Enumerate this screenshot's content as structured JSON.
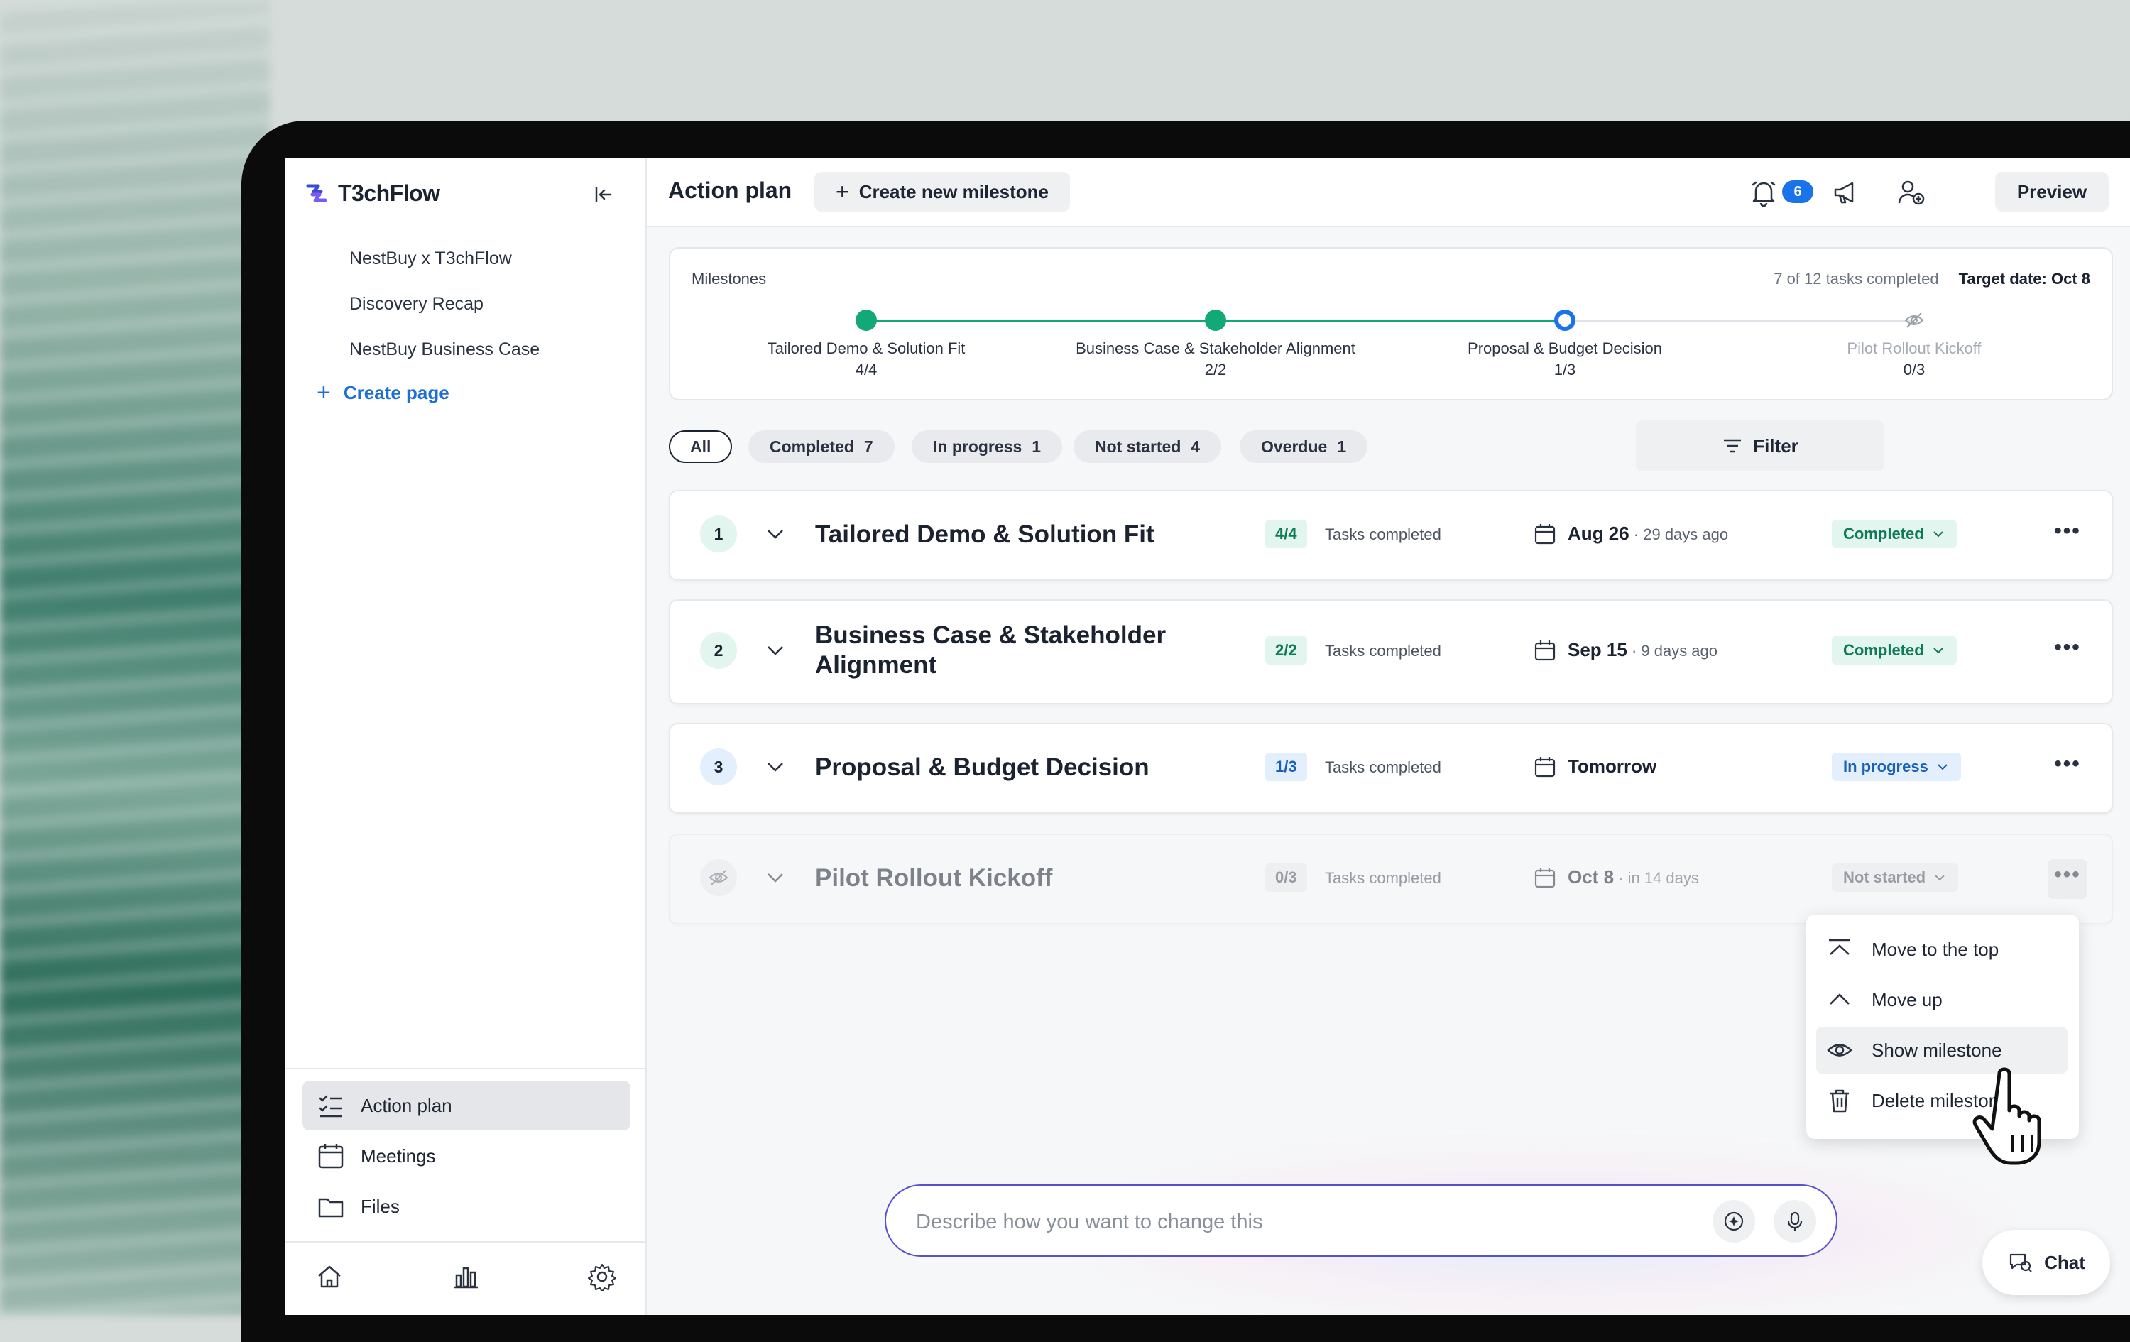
{
  "app": {
    "name": "T3chFlow",
    "brand_color": "#3b4bd8"
  },
  "sidebar": {
    "pages": [
      {
        "label": "NestBuy x T3chFlow"
      },
      {
        "label": "Discovery Recap"
      },
      {
        "label": "NestBuy Business Case"
      }
    ],
    "create_page_label": "Create page",
    "nav": [
      {
        "label": "Action plan",
        "icon": "checklist-icon",
        "active": true
      },
      {
        "label": "Meetings",
        "icon": "calendar-icon",
        "active": false
      },
      {
        "label": "Files",
        "icon": "folder-icon",
        "active": false
      }
    ],
    "bottom_icons": [
      "home-icon",
      "analytics-icon",
      "settings-icon"
    ]
  },
  "header": {
    "title": "Action plan",
    "create_milestone_label": "Create new milestone",
    "notification_count": "6",
    "preview_label": "Preview"
  },
  "milestones_card": {
    "label": "Milestones",
    "tasks_summary": "7 of 12 tasks completed",
    "target_date": "Target date: Oct 8",
    "steps": [
      {
        "name": "Tailored Demo & Solution Fit",
        "count": "4/4",
        "state": "completed"
      },
      {
        "name": "Business Case & Stakeholder Alignment",
        "count": "2/2",
        "state": "completed"
      },
      {
        "name": "Proposal & Budget Decision",
        "count": "1/3",
        "state": "current"
      },
      {
        "name": "Pilot Rollout Kickoff",
        "count": "0/3",
        "state": "hidden"
      }
    ]
  },
  "filters": {
    "all_label": "All",
    "chips": [
      {
        "label": "Completed",
        "count": "7"
      },
      {
        "label": "In progress",
        "count": "1"
      },
      {
        "label": "Not started",
        "count": "4"
      },
      {
        "label": "Overdue",
        "count": "1"
      }
    ],
    "filter_label": "Filter"
  },
  "rows": [
    {
      "num": "1",
      "title": "Tailored Demo & Solution Fit",
      "tasks": "4/4",
      "tasks_label": "Tasks completed",
      "date": "Aug 26",
      "date_sub": " · 29 days ago",
      "status": "Completed"
    },
    {
      "num": "2",
      "title": "Business Case & Stakeholder Alignment",
      "tasks": "2/2",
      "tasks_label": "Tasks completed",
      "date": "Sep 15",
      "date_sub": " · 9 days ago",
      "status": "Completed"
    },
    {
      "num": "3",
      "title": "Proposal & Budget Decision",
      "tasks": "1/3",
      "tasks_label": "Tasks completed",
      "date": "Tomorrow",
      "date_sub": "",
      "status": "In progress"
    },
    {
      "num": "",
      "title": "Pilot Rollout Kickoff",
      "tasks": "0/3",
      "tasks_label": "Tasks completed",
      "date": "Oct 8",
      "date_sub": " · in 14 days",
      "status": "Not started"
    }
  ],
  "context_menu": {
    "items": [
      {
        "label": "Move to the top",
        "icon": "move-to-top-icon"
      },
      {
        "label": "Move up",
        "icon": "chevron-up-icon"
      },
      {
        "label": "Show milestone",
        "icon": "eye-icon"
      },
      {
        "label": "Delete milestone",
        "icon": "trash-icon"
      }
    ]
  },
  "chat": {
    "placeholder": "Describe how you want to change this",
    "fab_label": "Chat"
  },
  "colors": {
    "green": "#12a877",
    "blue": "#1a73e8",
    "accent_purple": "#5a4fcf"
  }
}
